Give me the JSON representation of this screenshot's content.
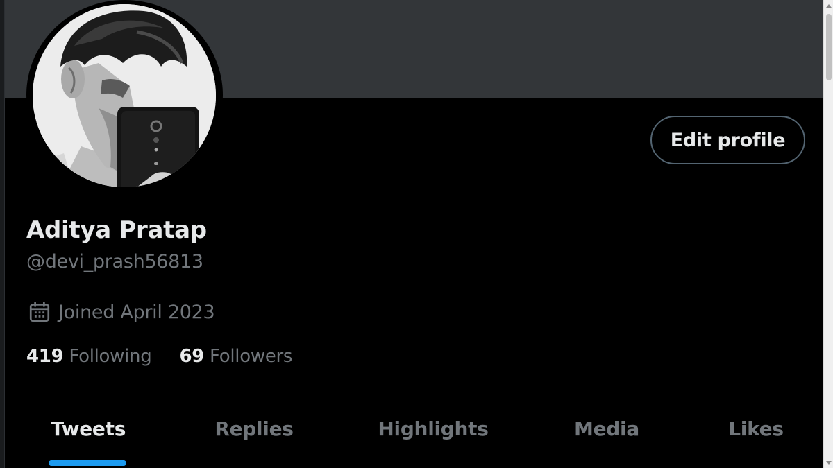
{
  "profile": {
    "display_name": "Aditya Pratap",
    "handle": "@devi_prash56813",
    "joined": "Joined April 2023",
    "edit_button_label": "Edit profile",
    "following_count": "419",
    "following_label": "Following",
    "followers_count": "69",
    "followers_label": "Followers"
  },
  "tabs": [
    {
      "label": "Tweets",
      "active": true
    },
    {
      "label": "Replies",
      "active": false
    },
    {
      "label": "Highlights",
      "active": false
    },
    {
      "label": "Media",
      "active": false
    },
    {
      "label": "Likes",
      "active": false
    }
  ],
  "icons": {
    "calendar": "calendar-icon",
    "avatar": "avatar-photo"
  },
  "colors": {
    "background": "#000000",
    "banner": "#333639",
    "primary_text": "#e7e9ea",
    "secondary_text": "#71767b",
    "accent": "#1d9bf0",
    "button_border": "#536471"
  }
}
